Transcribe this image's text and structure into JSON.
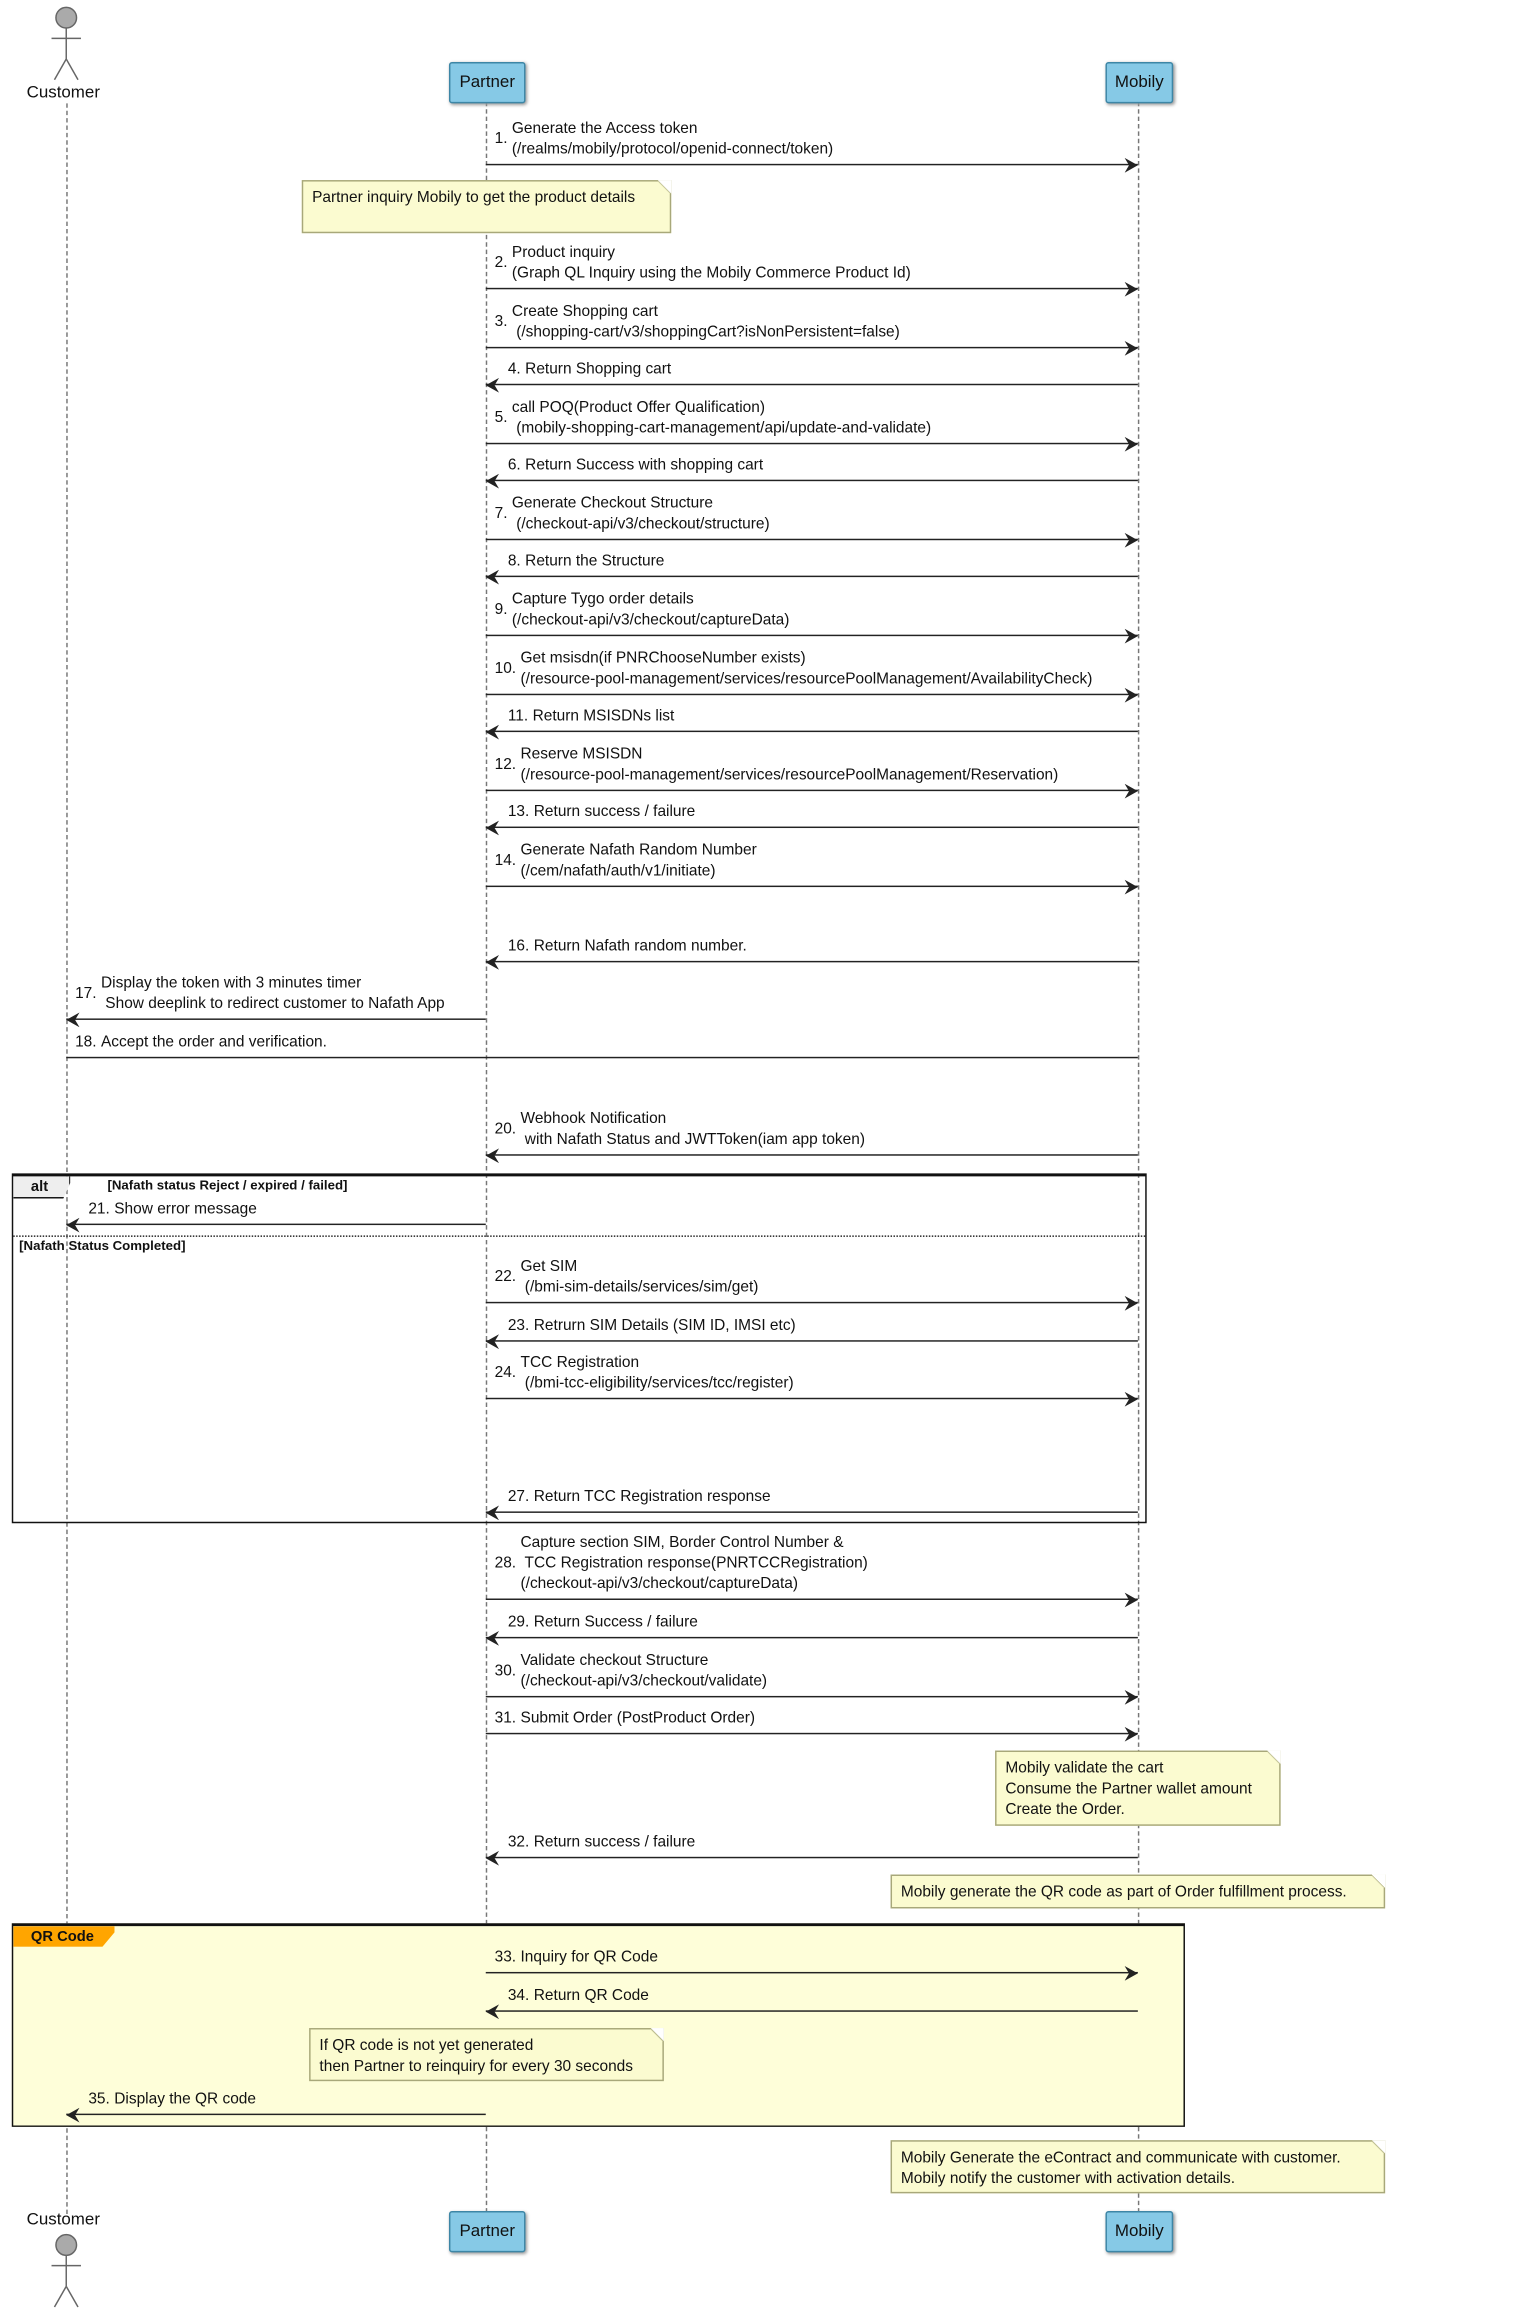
{
  "participants": {
    "customer": "Customer",
    "partner": "Partner",
    "mobily": "Mobily"
  },
  "colors": {
    "participant_fill": "#86c9e6",
    "note_fill": "#fbfbd0",
    "qr_frame_fill": "#fefed9",
    "qr_tab": "#ffa500"
  },
  "messages": [
    {
      "num": "1.",
      "from": "partner",
      "to": "mobily",
      "lines": [
        "Generate the Access token",
        "(/realms/mobily/protocol/openid-connect/token)"
      ]
    },
    {
      "num": "2.",
      "from": "partner",
      "to": "mobily",
      "lines": [
        "Product inquiry",
        "(Graph QL Inquiry using the Mobily Commerce Product Id)"
      ]
    },
    {
      "num": "3.",
      "from": "partner",
      "to": "mobily",
      "lines": [
        "Create Shopping cart",
        " (/shopping-cart/v3/shoppingCart?isNonPersistent=false)"
      ]
    },
    {
      "num": "4.",
      "from": "mobily",
      "to": "partner",
      "lines": [
        "Return Shopping cart"
      ]
    },
    {
      "num": "5.",
      "from": "partner",
      "to": "mobily",
      "lines": [
        "call POQ(Product Offer Qualification)",
        " (mobily-shopping-cart-management/api/update-and-validate)"
      ]
    },
    {
      "num": "6.",
      "from": "mobily",
      "to": "partner",
      "lines": [
        "Return Success with shopping cart"
      ]
    },
    {
      "num": "7.",
      "from": "partner",
      "to": "mobily",
      "lines": [
        "Generate Checkout Structure",
        " (/checkout-api/v3/checkout/structure)"
      ]
    },
    {
      "num": "8.",
      "from": "mobily",
      "to": "partner",
      "lines": [
        "Return the Structure"
      ]
    },
    {
      "num": "9.",
      "from": "partner",
      "to": "mobily",
      "lines": [
        "Capture Tygo order details",
        "(/checkout-api/v3/checkout/captureData)"
      ]
    },
    {
      "num": "10.",
      "from": "partner",
      "to": "mobily",
      "lines": [
        "Get msisdn(if PNRChooseNumber exists)",
        "(/resource-pool-management/services/resourcePoolManagement/AvailabilityCheck)"
      ]
    },
    {
      "num": "11.",
      "from": "mobily",
      "to": "partner",
      "lines": [
        "Return MSISDNs list"
      ]
    },
    {
      "num": "12.",
      "from": "partner",
      "to": "mobily",
      "lines": [
        "Reserve MSISDN",
        "(/resource-pool-management/services/resourcePoolManagement/Reservation)"
      ]
    },
    {
      "num": "13.",
      "from": "mobily",
      "to": "partner",
      "lines": [
        "Return success / failure"
      ]
    },
    {
      "num": "14.",
      "from": "partner",
      "to": "mobily",
      "lines": [
        "Generate Nafath Random Number",
        "(/cem/nafath/auth/v1/initiate)"
      ]
    },
    {
      "num": "16.",
      "from": "mobily",
      "to": "partner",
      "lines": [
        "Return Nafath random number."
      ]
    },
    {
      "num": "17.",
      "from": "partner",
      "to": "customer",
      "lines": [
        "Display the token with 3 minutes timer",
        " Show deeplink to redirect customer to Nafath App"
      ]
    },
    {
      "num": "18.",
      "from": "customer",
      "to": "mobily",
      "lines": [
        "Accept the order and verification."
      ]
    },
    {
      "num": "20.",
      "from": "mobily",
      "to": "partner",
      "lines": [
        "Webhook Notification",
        " with Nafath Status and JWTToken(iam app token)"
      ]
    },
    {
      "num": "21.",
      "from": "partner",
      "to": "customer",
      "lines": [
        "Show error message"
      ]
    },
    {
      "num": "22.",
      "from": "partner",
      "to": "mobily",
      "lines": [
        "Get SIM",
        " (/bmi-sim-details/services/sim/get)"
      ]
    },
    {
      "num": "23.",
      "from": "mobily",
      "to": "partner",
      "lines": [
        "Retrurn SIM Details (SIM ID, IMSI etc)"
      ]
    },
    {
      "num": "24.",
      "from": "partner",
      "to": "mobily",
      "lines": [
        "TCC Registration",
        " (/bmi-tcc-eligibility/services/tcc/register)"
      ]
    },
    {
      "num": "27.",
      "from": "mobily",
      "to": "partner",
      "lines": [
        "Return TCC Registration response"
      ]
    },
    {
      "num": "28.",
      "from": "partner",
      "to": "mobily",
      "lines": [
        "Capture section SIM, Border Control Number &",
        " TCC Registration response(PNRTCCRegistration)",
        "(/checkout-api/v3/checkout/captureData)"
      ]
    },
    {
      "num": "29.",
      "from": "mobily",
      "to": "partner",
      "lines": [
        "Return Success / failure"
      ]
    },
    {
      "num": "30.",
      "from": "partner",
      "to": "mobily",
      "lines": [
        "Validate checkout Structure",
        "(/checkout-api/v3/checkout/validate)"
      ]
    },
    {
      "num": "31.",
      "from": "partner",
      "to": "mobily",
      "lines": [
        "Submit Order (PostProduct Order)"
      ]
    },
    {
      "num": "32.",
      "from": "mobily",
      "to": "partner",
      "lines": [
        "Return success / failure"
      ]
    },
    {
      "num": "33.",
      "from": "partner",
      "to": "mobily",
      "lines": [
        "Inquiry for QR Code"
      ]
    },
    {
      "num": "34.",
      "from": "mobily",
      "to": "partner",
      "lines": [
        "Return QR Code"
      ]
    },
    {
      "num": "35.",
      "from": "partner",
      "to": "customer",
      "lines": [
        "Display the QR code"
      ]
    }
  ],
  "notes": [
    "Partner inquiry Mobily to get the product details",
    "Mobily validate the cart\nConsume the Partner wallet amount\nCreate the Order.",
    "Mobily generate the QR code as part of Order fulfillment process.",
    "If QR code is not yet generated\nthen Partner to reinquiry for every 30 seconds",
    "Mobily Generate the eContract and communicate with customer.\nMobily notify the customer with activation details."
  ],
  "alt_frame": {
    "label": "alt",
    "condition1": "[Nafath status Reject / expired / failed]",
    "condition2": "[Nafath Status Completed]"
  },
  "qr_frame": {
    "label": "QR Code"
  }
}
